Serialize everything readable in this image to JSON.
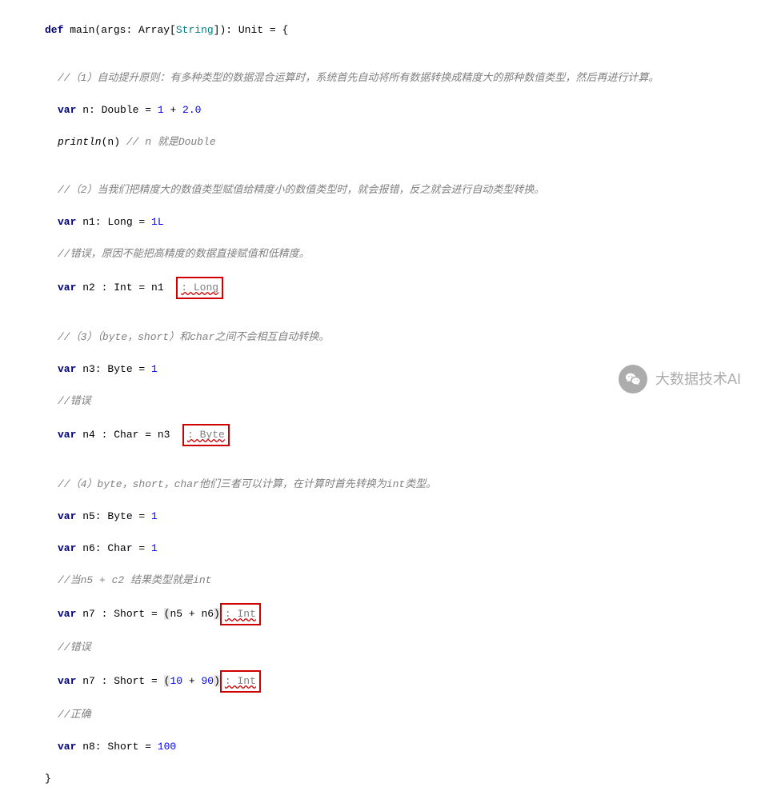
{
  "sig": {
    "def": "def",
    "name": "main",
    "args_open": "(args: Array[",
    "string_type": "String",
    "args_close": "]): Unit = {"
  },
  "sec1": {
    "comment": "//（1）自动提升原则：有多种类型的数据混合运算时，系统首先自动将所有数据转换成精度大的那种数值类型，然后再进行计算。",
    "d1_kw": "var",
    "d1_name": " n: Double = ",
    "d1_v1": "1",
    "d1_plus": " + ",
    "d1_v2": "2.0",
    "p_open": "println",
    "p_arg": "(n) ",
    "p_comment": "// n 就是Double"
  },
  "sec2": {
    "comment": "//（2）当我们把精度大的数值类型赋值给精度小的数值类型时，就会报错，反之就会进行自动类型转换。",
    "d1_kw": "var",
    "d1_rest": " n1: Long = ",
    "d1_val": "1L",
    "err_comment": "//错误，原因不能把高精度的数据直接赋值和低精度。",
    "d2_kw": "var",
    "d2_mid": " n2 : Int = n1  ",
    "d2_err": ": Long"
  },
  "sec3": {
    "comment": "//（3）（byte，short）和char之间不会相互自动转换。",
    "d1_kw": "var",
    "d1_rest": " n3: Byte = ",
    "d1_val": "1",
    "err_comment": "//错误",
    "d2_kw": "var",
    "d2_mid": " n4 : Char = n3  ",
    "d2_err": ": Byte"
  },
  "sec4": {
    "comment": "//（4）byte，short，char他们三者可以计算，在计算时首先转换为int类型。",
    "d1_kw": "var",
    "d1_rest": " n5: Byte = ",
    "d1_val": "1",
    "d2_kw": "var",
    "d2_rest": " n6: Char = ",
    "d2_val": "1",
    "res_comment": "//当n5 + c2 结果类型就是int",
    "d3_kw": "var",
    "d3_mid": " n7 : Short = ",
    "d3_open": "(",
    "d3_expr": "n5 + n6",
    "d3_close": ")",
    "d3_err": ": Int",
    "err_comment": "//错误",
    "d4_kw": "var",
    "d4_mid": " n7 : Short = ",
    "d4_open": "(",
    "d4_v1": "10",
    "d4_plus": " + ",
    "d4_v2": "90",
    "d4_close": ")",
    "d4_err": ": Int",
    "ok_comment": "//正确",
    "d5_kw": "var",
    "d5_rest": " n8: Short = ",
    "d5_val": "100"
  },
  "close": "}",
  "watermark": "大数据技术AI"
}
